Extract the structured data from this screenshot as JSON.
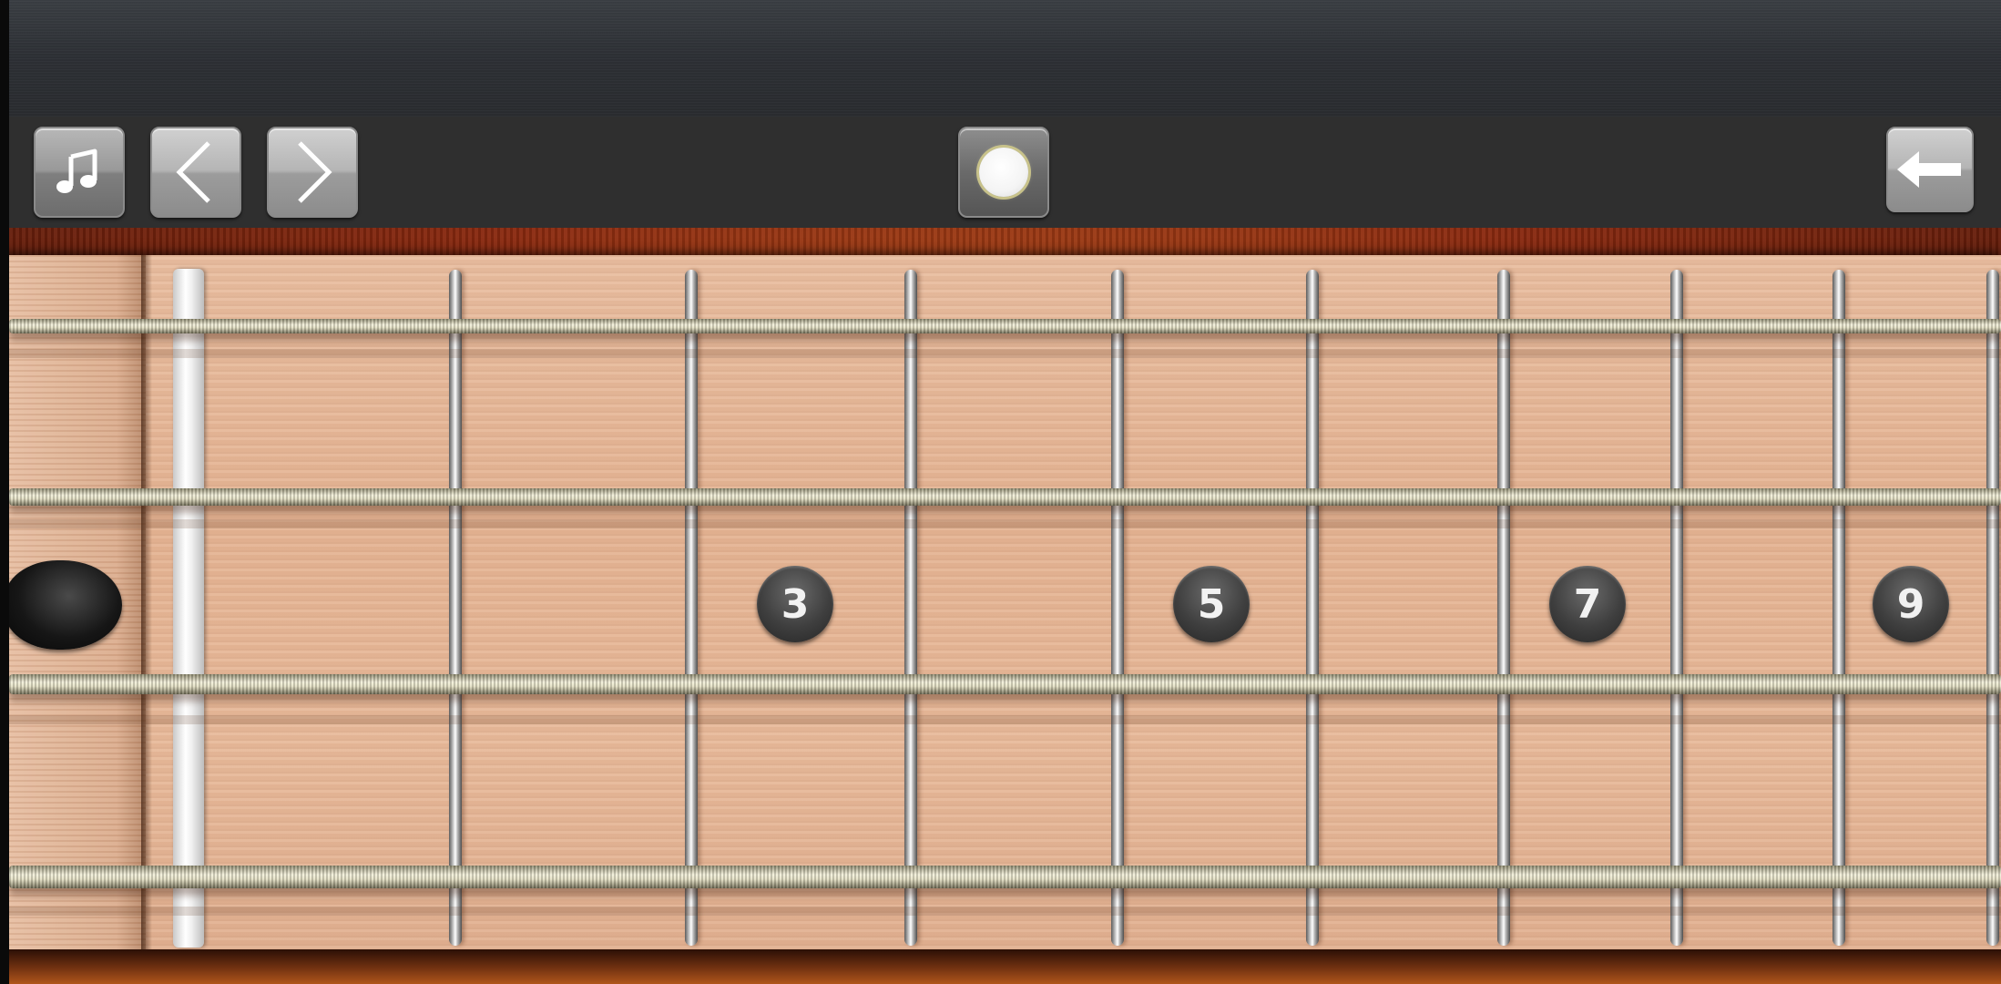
{
  "toolbar": {
    "buttons": [
      {
        "name": "music-note",
        "icon": "music-note-icon"
      },
      {
        "name": "previous",
        "icon": "chevron-left-icon"
      },
      {
        "name": "next",
        "icon": "chevron-right-icon"
      },
      {
        "name": "record",
        "icon": "record-icon"
      },
      {
        "name": "back",
        "icon": "arrow-left-icon"
      }
    ]
  },
  "fretboard": {
    "string_count": 4,
    "fret_marker_labels": [
      "3",
      "5",
      "7",
      "9"
    ]
  },
  "colors": {
    "fretboard_wood": "#e6b797",
    "body_finish": "#8b2a10",
    "toolbar_bg": "#2f2f2f",
    "marker_dot": "#3f3f3f"
  }
}
